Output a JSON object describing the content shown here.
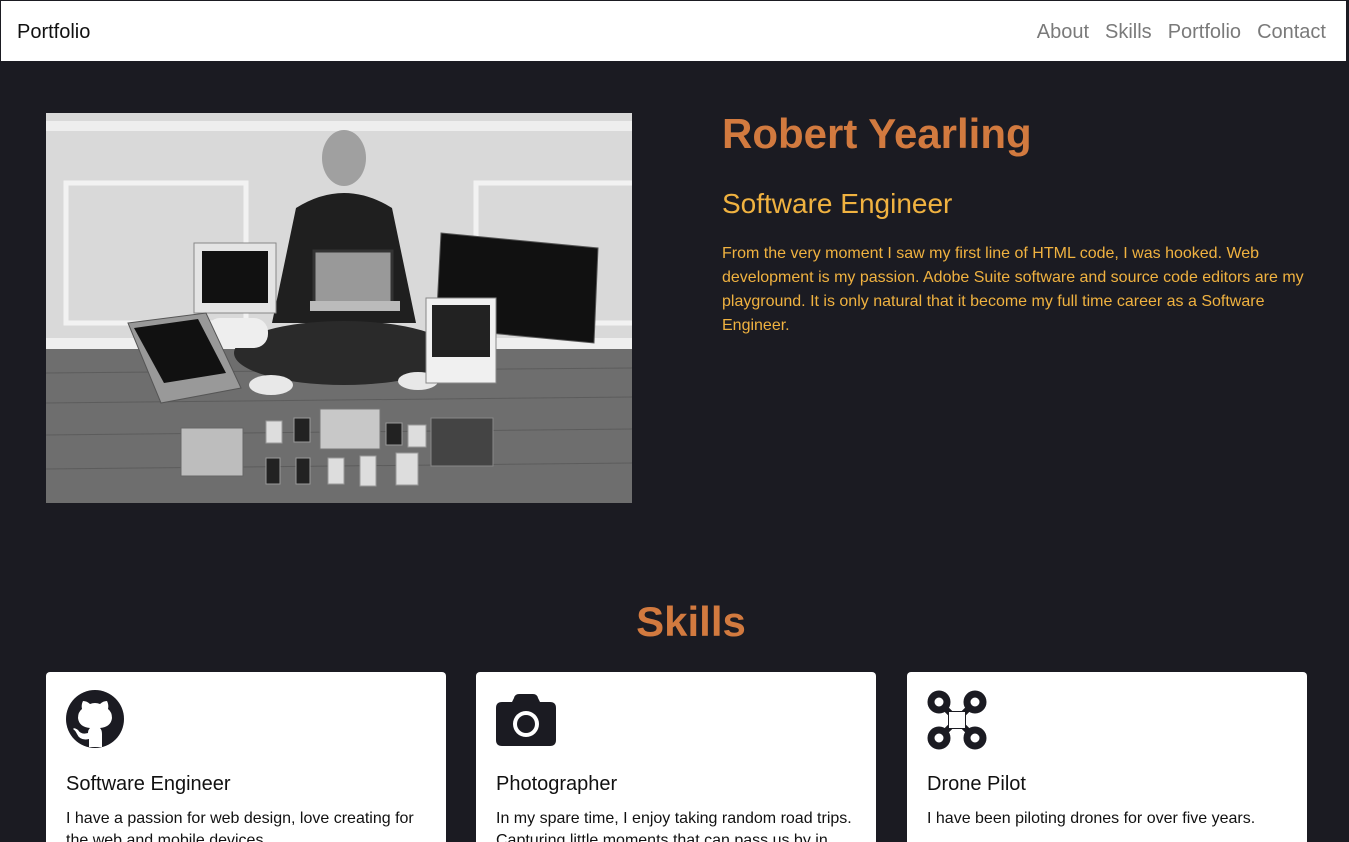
{
  "navbar": {
    "brand": "Portfolio",
    "links": [
      "About",
      "Skills",
      "Portfolio",
      "Contact"
    ]
  },
  "hero": {
    "name": "Robert Yearling",
    "title": "Software Engineer",
    "bio": "From the very moment I saw my first line of HTML code, I was hooked. Web development is my passion. Adobe Suite software and source code editors are my playground. It is only natural that it become my full time career as a Software Engineer.",
    "photo_icon": "person-with-devices-photo"
  },
  "skills": {
    "heading": "Skills",
    "cards": [
      {
        "icon": "github-icon",
        "title": "Software Engineer",
        "text": "I have a passion for web design, love creating for the web and mobile devices."
      },
      {
        "icon": "camera-icon",
        "title": "Photographer",
        "text": "In my spare time, I enjoy taking random road trips. Capturing little moments that can pass us by in"
      },
      {
        "icon": "drone-icon",
        "title": "Drone Pilot",
        "text": "I have been piloting drones for over five years."
      }
    ]
  },
  "colors": {
    "background": "#1b1b22",
    "name_orange": "#d27a3f",
    "accent_yellow": "#f0b240"
  }
}
